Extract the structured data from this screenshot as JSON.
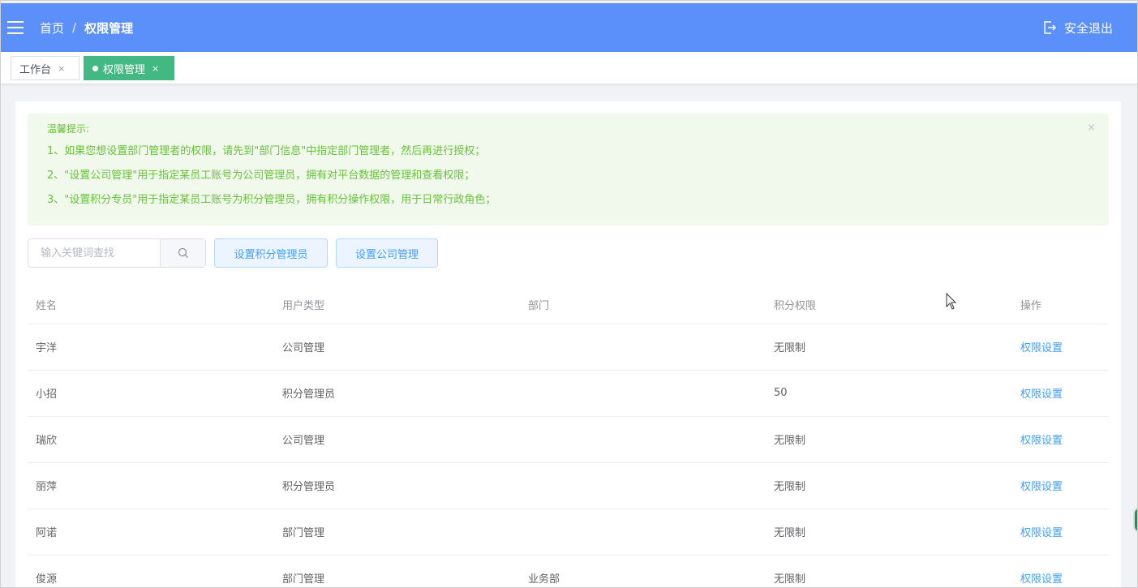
{
  "header": {
    "breadcrumb": [
      "首页",
      "/",
      "权限管理"
    ],
    "logout_label": "安全退出",
    "bg_color": "#5b8ff9"
  },
  "tabs": [
    {
      "label": "工作台",
      "close": "×",
      "active": false
    },
    {
      "label": "权限管理",
      "close": "×",
      "active": true
    }
  ],
  "alert": {
    "title": "温馨提示:",
    "lines": [
      "1、如果您想设置部门管理者的权限，请先到\"部门信息\"中指定部门管理者，然后再进行授权；",
      "2、\"设置公司管理\"用于指定某员工账号为公司管理员，拥有对平台数据的管理和查看权限；",
      "3、\"设置积分专员\"用于指定某员工账号为积分管理员，拥有积分操作权限，用于日常行政角色；"
    ],
    "close": "×"
  },
  "search": {
    "placeholder": "输入关键词查找",
    "icon": "search-icon"
  },
  "actions": {
    "set_points_admin": "设置积分管理员",
    "set_company_admin": "设置公司管理"
  },
  "table": {
    "headers": [
      "姓名",
      "用户类型",
      "部门",
      "积分权限",
      "操作"
    ],
    "rows": [
      {
        "name": "宇洋",
        "type": "公司管理",
        "dept": "",
        "points": "无限制",
        "op": "权限设置"
      },
      {
        "name": "小招",
        "type": "积分管理员",
        "dept": "",
        "points": "50",
        "op": "权限设置"
      },
      {
        "name": "瑞欣",
        "type": "公司管理",
        "dept": "",
        "points": "无限制",
        "op": "权限设置"
      },
      {
        "name": "丽萍",
        "type": "积分管理员",
        "dept": "",
        "points": "无限制",
        "op": "权限设置"
      },
      {
        "name": "阿诺",
        "type": "部门管理",
        "dept": "",
        "points": "无限制",
        "op": "权限设置"
      },
      {
        "name": "俊源",
        "type": "部门管理",
        "dept": "业务部",
        "points": "无限制",
        "op": "权限设置"
      }
    ]
  }
}
